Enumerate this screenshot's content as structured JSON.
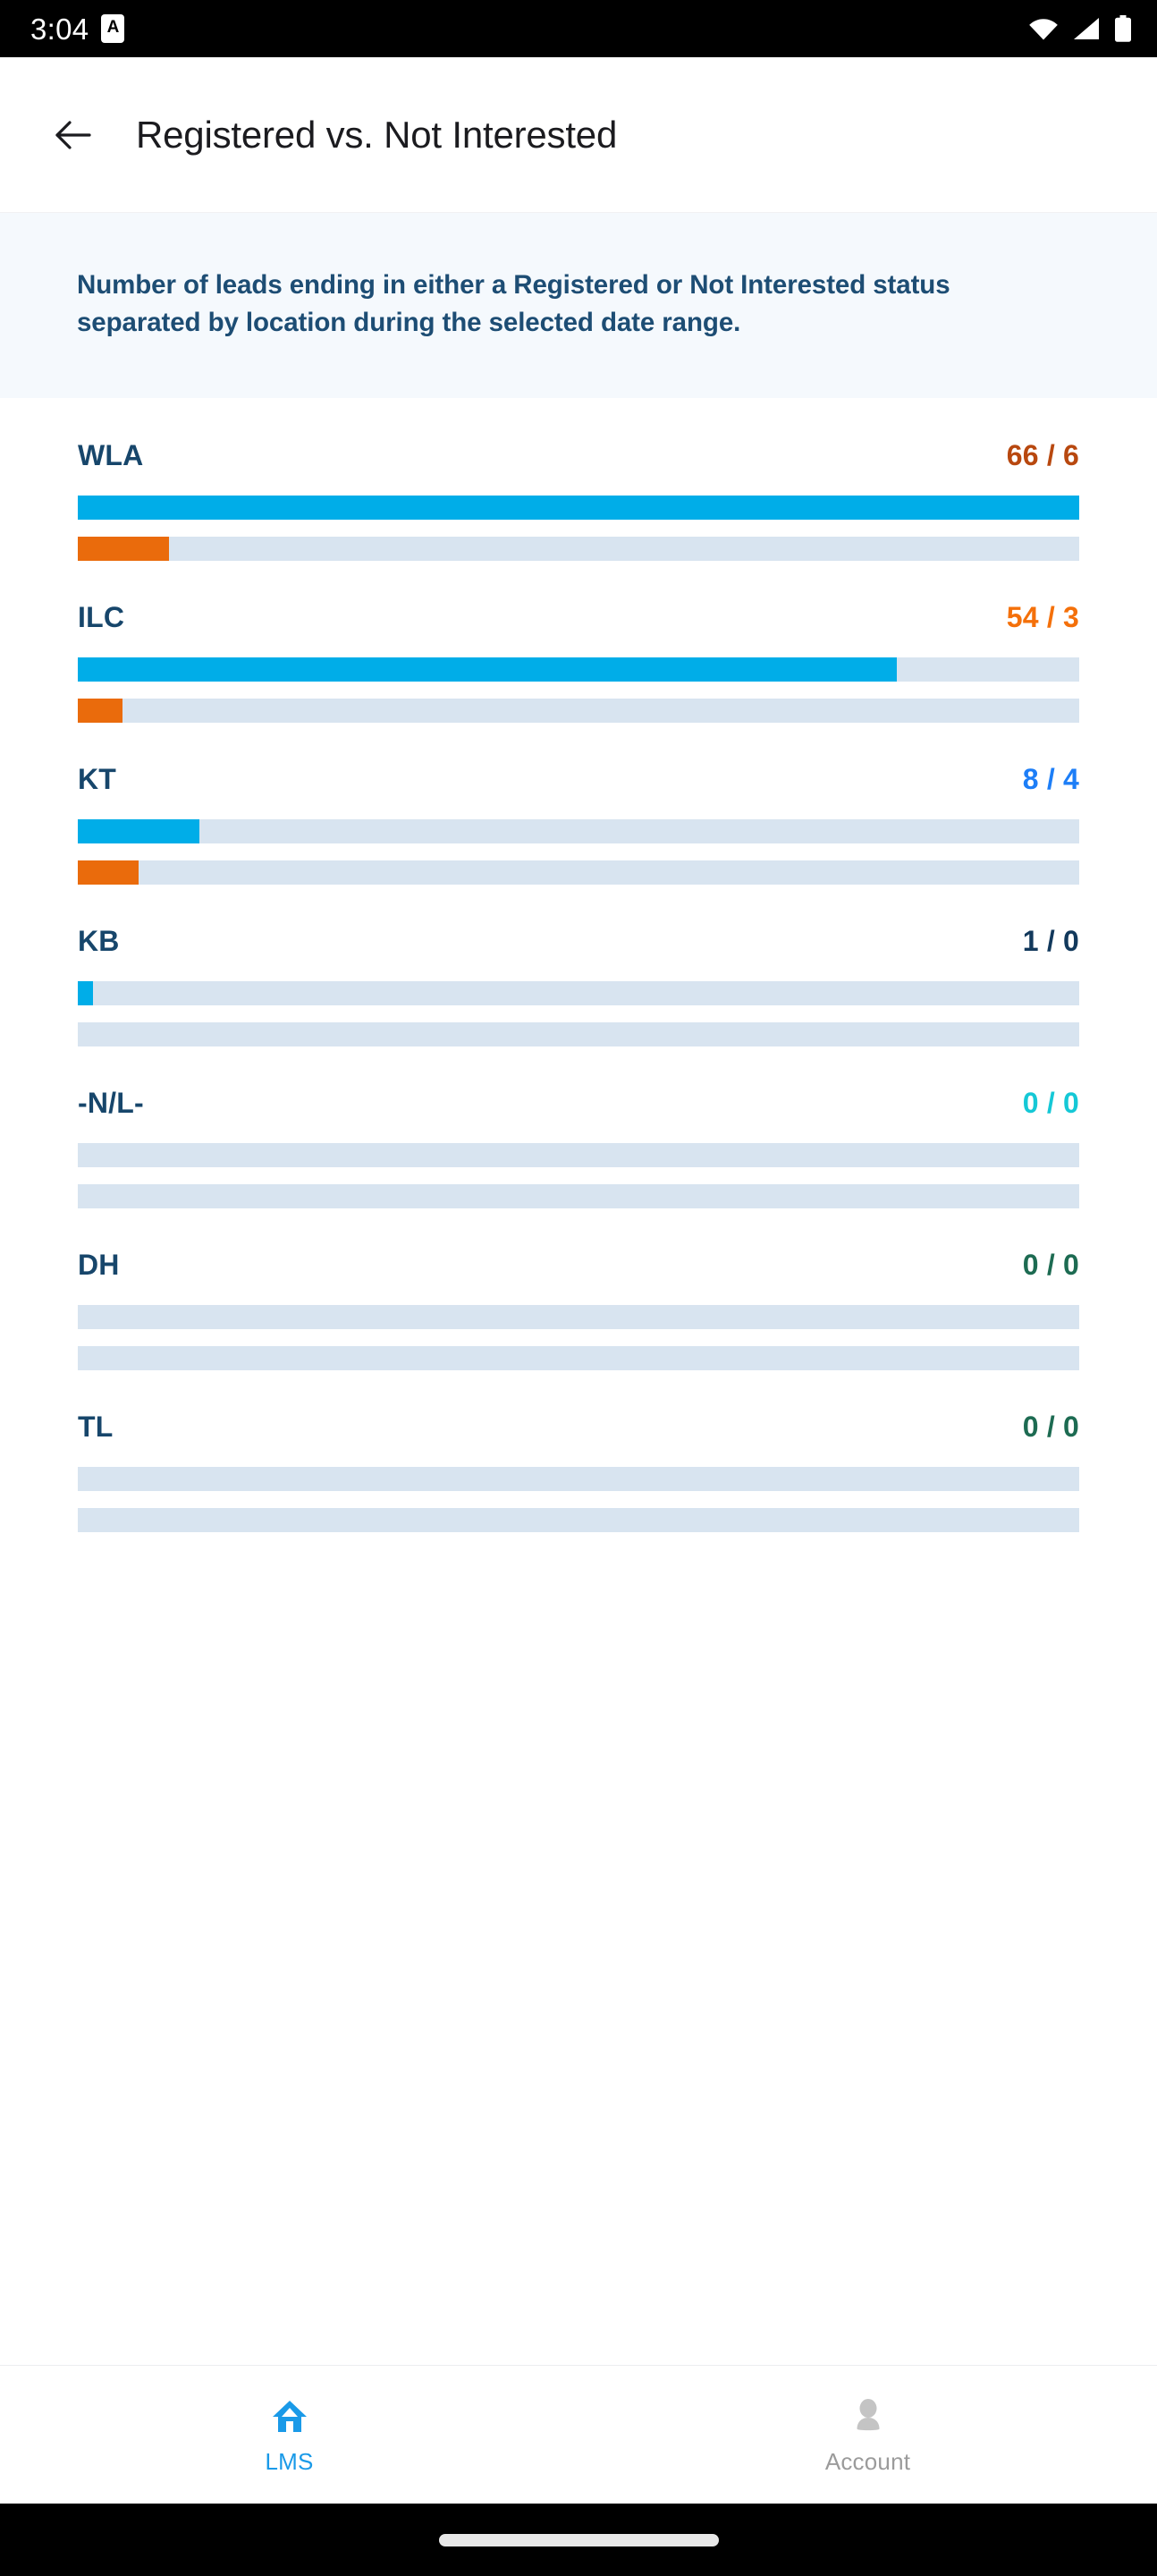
{
  "status_bar": {
    "time": "3:04",
    "app_badge_letter": "A",
    "icons": [
      "wifi-icon",
      "cellular-signal-icon",
      "battery-icon"
    ]
  },
  "app_bar": {
    "back_icon": "back-arrow-icon",
    "title": "Registered vs. Not Interested"
  },
  "banner": {
    "description": "Number of leads ending in either a Registered or Not Interested status separated by location during the selected date range."
  },
  "colors": {
    "registered_bar": "#00ade8",
    "not_interested_bar": "#ea6b0c",
    "bar_track": "#d8e4f0",
    "banner_bg": "#f5f9fd",
    "banner_text": "#1d4d74",
    "label_text": "#17466b",
    "nav_active": "#1a9ae8",
    "nav_inactive": "#9b9b9b"
  },
  "chart_data": {
    "type": "bar",
    "title": "Registered vs. Not Interested",
    "subtitle": "Number of leads ending in either a Registered or Not Interested status separated by location during the selected date range.",
    "orientation": "horizontal",
    "xlabel": "",
    "ylabel": "",
    "grid": false,
    "legend_position": "none",
    "max_value": 66,
    "categories": [
      "WLA",
      "ILC",
      "KT",
      "KB",
      "-N/L-",
      "DH",
      "TL"
    ],
    "series": [
      {
        "name": "Registered",
        "color": "#00ade8",
        "values": [
          66,
          54,
          8,
          1,
          0,
          0,
          0
        ]
      },
      {
        "name": "Not Interested",
        "color": "#ea6b0c",
        "values": [
          6,
          3,
          4,
          0,
          0,
          0,
          0
        ]
      }
    ],
    "rows": [
      {
        "label": "WLA",
        "value_text": "66 / 6",
        "value_color": "#b8480f",
        "registered": 66,
        "not_interested": 6,
        "registered_pct": 100.0,
        "not_interested_pct": 9.1
      },
      {
        "label": "ILC",
        "value_text": "54 / 3",
        "value_color": "#f4700a",
        "registered": 54,
        "not_interested": 3,
        "registered_pct": 81.8,
        "not_interested_pct": 4.5
      },
      {
        "label": "KT",
        "value_text": "8 / 4",
        "value_color": "#1d7ef7",
        "registered": 8,
        "not_interested": 4,
        "registered_pct": 12.1,
        "not_interested_pct": 6.1
      },
      {
        "label": "KB",
        "value_text": "1 / 0",
        "value_color": "#12395c",
        "registered": 1,
        "not_interested": 0,
        "registered_pct": 1.5,
        "not_interested_pct": 0
      },
      {
        "label": "-N/L-",
        "value_text": "0 / 0",
        "value_color": "#15c8d6",
        "registered": 0,
        "not_interested": 0,
        "registered_pct": 0,
        "not_interested_pct": 0
      },
      {
        "label": "DH",
        "value_text": "0 / 0",
        "value_color": "#1d6b52",
        "registered": 0,
        "not_interested": 0,
        "registered_pct": 0,
        "not_interested_pct": 0
      },
      {
        "label": "TL",
        "value_text": "0 / 0",
        "value_color": "#1d6b52",
        "registered": 0,
        "not_interested": 0,
        "registered_pct": 0,
        "not_interested_pct": 0
      }
    ]
  },
  "bottom_nav": {
    "items": [
      {
        "label": "LMS",
        "icon": "home-icon",
        "active": true
      },
      {
        "label": "Account",
        "icon": "person-icon",
        "active": false
      }
    ]
  }
}
